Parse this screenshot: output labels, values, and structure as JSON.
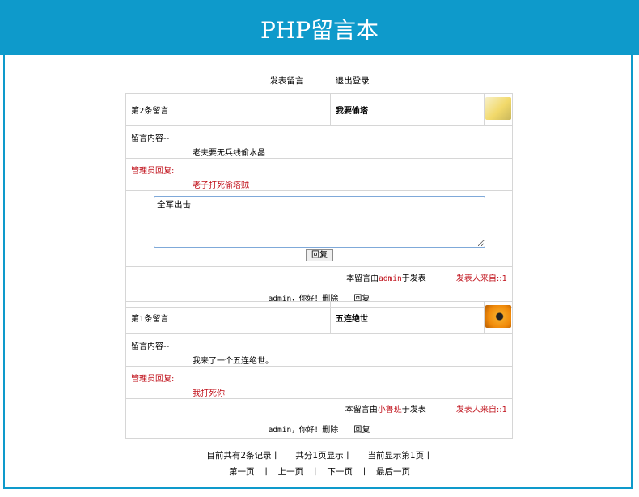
{
  "app": {
    "title": "PHP留言本"
  },
  "nav": {
    "post": "发表留言",
    "logout": "退出登录"
  },
  "reply_box": {
    "value": "全军出击",
    "button": "回复"
  },
  "messages": [
    {
      "number_label": "第2条留言",
      "title": "我要偷塔",
      "content_label": "留言内容--",
      "content": "老夫要无兵线偷水晶",
      "admin_label": "管理员回复:",
      "admin_reply": "老子打死偷塔贼",
      "by_prefix": "本留言由",
      "author": "admin",
      "by_suffix": "于发表",
      "source": "发表人来自::1",
      "admin_greeting": "admin，你好！",
      "delete": "删除",
      "reply": "回复"
    },
    {
      "number_label": "第1条留言",
      "title": "五连绝世",
      "content_label": "留言内容--",
      "content": "我来了一个五连绝世。",
      "admin_label": "管理员回复:",
      "admin_reply": "我打死你",
      "by_prefix": "本留言由",
      "author": "小鲁班",
      "by_suffix": "于发表",
      "source": "发表人来自::1",
      "admin_greeting": "admin，你好！",
      "delete": "删除",
      "reply": "回复"
    }
  ],
  "pagination": {
    "total": "目前共有2条记录丨",
    "pages": "共分1页显示丨",
    "current": "当前显示第1页丨",
    "first": "第一页",
    "sep": "丨",
    "prev": "上一页",
    "next": "下一页",
    "last": "最后一页"
  }
}
